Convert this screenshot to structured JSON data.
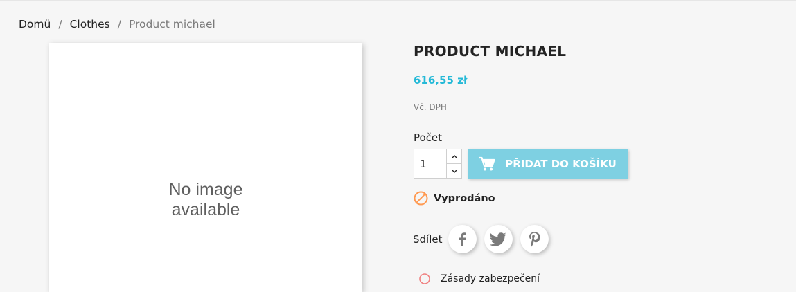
{
  "breadcrumb": {
    "items": [
      "Domů",
      "Clothes"
    ],
    "current": "Product michael",
    "separator": "/"
  },
  "product": {
    "image_placeholder": "No image\navailable",
    "title": "PRODUCT MICHAEL",
    "price": "616,55 zł",
    "tax_label": "Vč. DPH",
    "quantity_label": "Počet",
    "quantity_value": "1",
    "add_to_cart_label": "PŘIDAT DO KOŠÍKU",
    "availability": "Vyprodáno"
  },
  "share": {
    "label": "Sdílet",
    "networks": [
      "facebook-icon",
      "twitter-icon",
      "pinterest-icon"
    ]
  },
  "reassurance": {
    "item_label": "Zásady zabezpečení"
  },
  "colors": {
    "accent": "#24b9d7",
    "button_disabled": "#7ed0e2",
    "unavailable": "#ff9a52"
  }
}
